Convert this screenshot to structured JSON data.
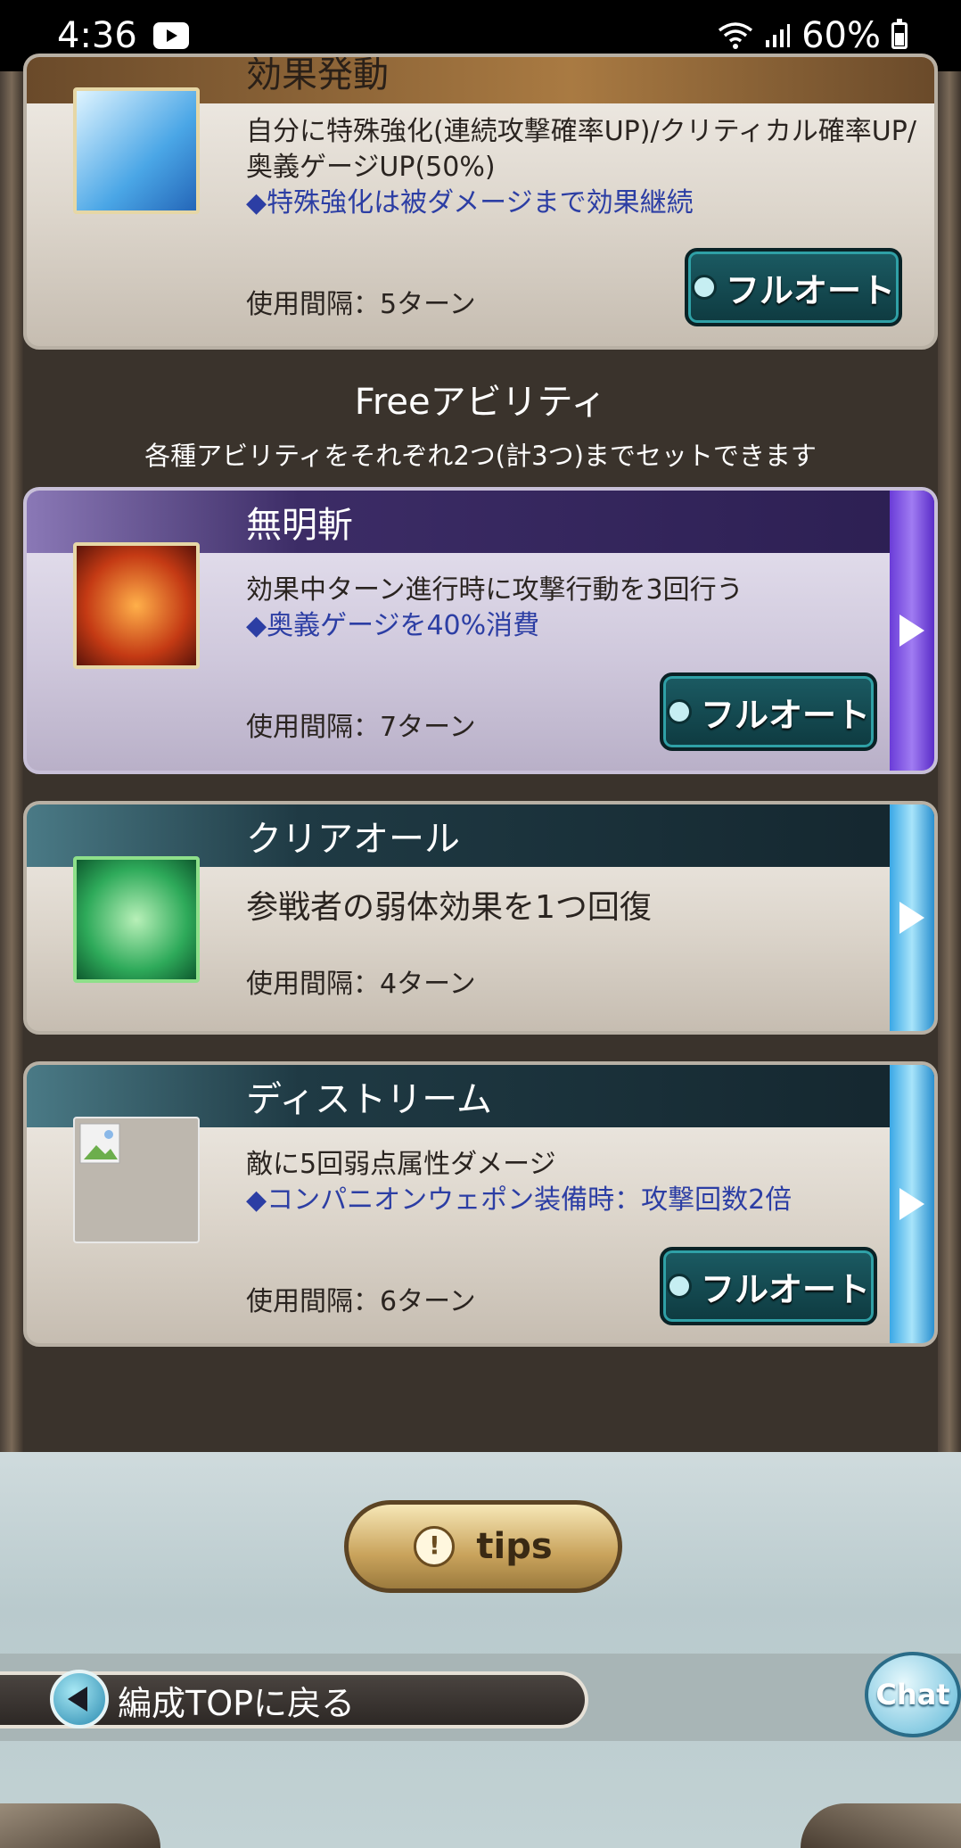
{
  "status_bar": {
    "time": "4:36",
    "battery": "60%"
  },
  "top_card": {
    "partial_title": "効果発動",
    "description": "自分に特殊強化(連続攻撃確率UP)/クリティカル確率UP/奥義ゲージUP(50%)",
    "note": "◆特殊強化は被ダメージまで効果継続",
    "interval": "使用間隔：5ターン",
    "button": "フルオート"
  },
  "free_section": {
    "title": "Freeアビリティ",
    "subtitle": "各種アビリティをそれぞれ2つ(計3つ)までセットできます"
  },
  "abilities": [
    {
      "name": "無明斬",
      "description": "効果中ターン進行時に攻撃行動を3回行う",
      "note": "◆奥義ゲージを40%消費",
      "interval": "使用間隔：7ターン",
      "button": "フルオート"
    },
    {
      "name": "クリアオール",
      "description": "参戦者の弱体効果を1つ回復",
      "interval": "使用間隔：4ターン"
    },
    {
      "name": "ディストリーム",
      "description": "敵に5回弱点属性ダメージ",
      "note": "◆コンパニオンウェポン装備時：攻撃回数2倍",
      "interval": "使用間隔：6ターン",
      "button": "フルオート"
    }
  ],
  "tips_button": "tips",
  "back_button": "編成TOPに戻る",
  "chat_button": "Chat"
}
